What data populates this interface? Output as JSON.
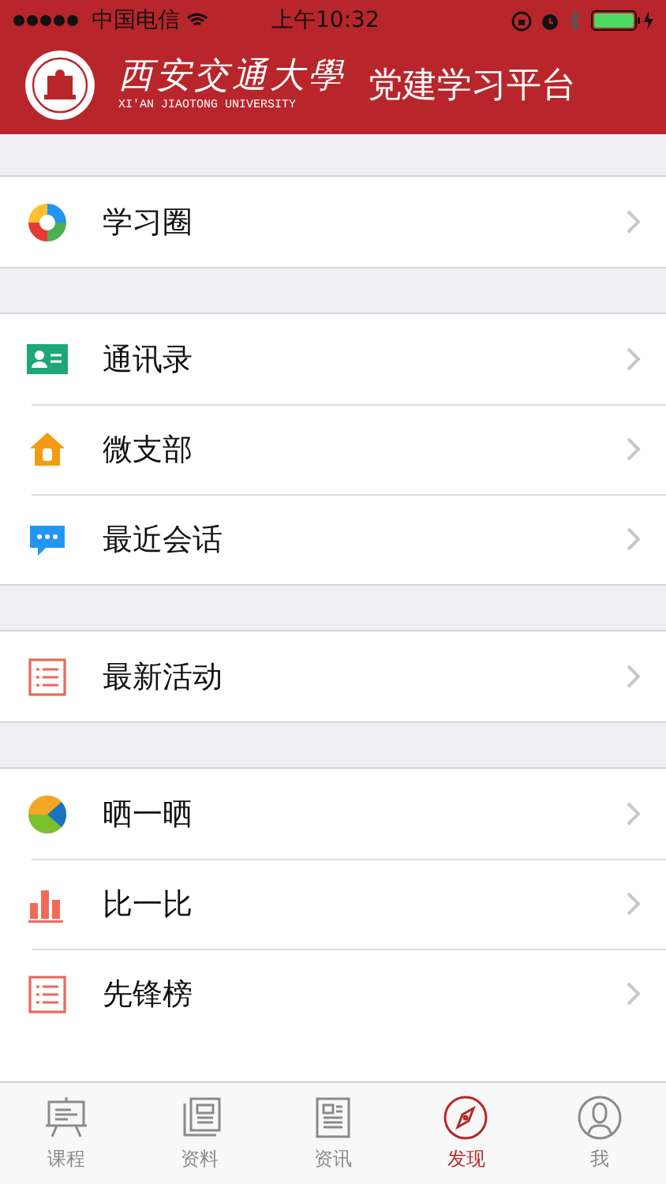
{
  "status_bar": {
    "carrier": "中国电信",
    "time": "上午10:32"
  },
  "header": {
    "logo_name": "西安交通大學",
    "logo_subtitle": "XI'AN JIAOTONG UNIVERSITY",
    "title": "党建学习平台"
  },
  "groups": [
    {
      "items": [
        {
          "label": "学习圈",
          "kind": "circle"
        }
      ]
    },
    {
      "items": [
        {
          "label": "通讯录",
          "kind": "contacts"
        },
        {
          "label": "微支部",
          "kind": "house"
        },
        {
          "label": "最近会话",
          "kind": "chat"
        }
      ]
    },
    {
      "items": [
        {
          "label": "最新活动",
          "kind": "list"
        }
      ]
    },
    {
      "items": [
        {
          "label": "晒一晒",
          "kind": "pie"
        },
        {
          "label": "比一比",
          "kind": "bars"
        },
        {
          "label": "先锋榜",
          "kind": "list"
        }
      ]
    }
  ],
  "tabs": [
    {
      "label": "课程",
      "kind": "board",
      "selected": false
    },
    {
      "label": "资料",
      "kind": "papers",
      "selected": false
    },
    {
      "label": "资讯",
      "kind": "news",
      "selected": false
    },
    {
      "label": "发现",
      "kind": "compass",
      "selected": true
    },
    {
      "label": "我",
      "kind": "person",
      "selected": false
    }
  ]
}
